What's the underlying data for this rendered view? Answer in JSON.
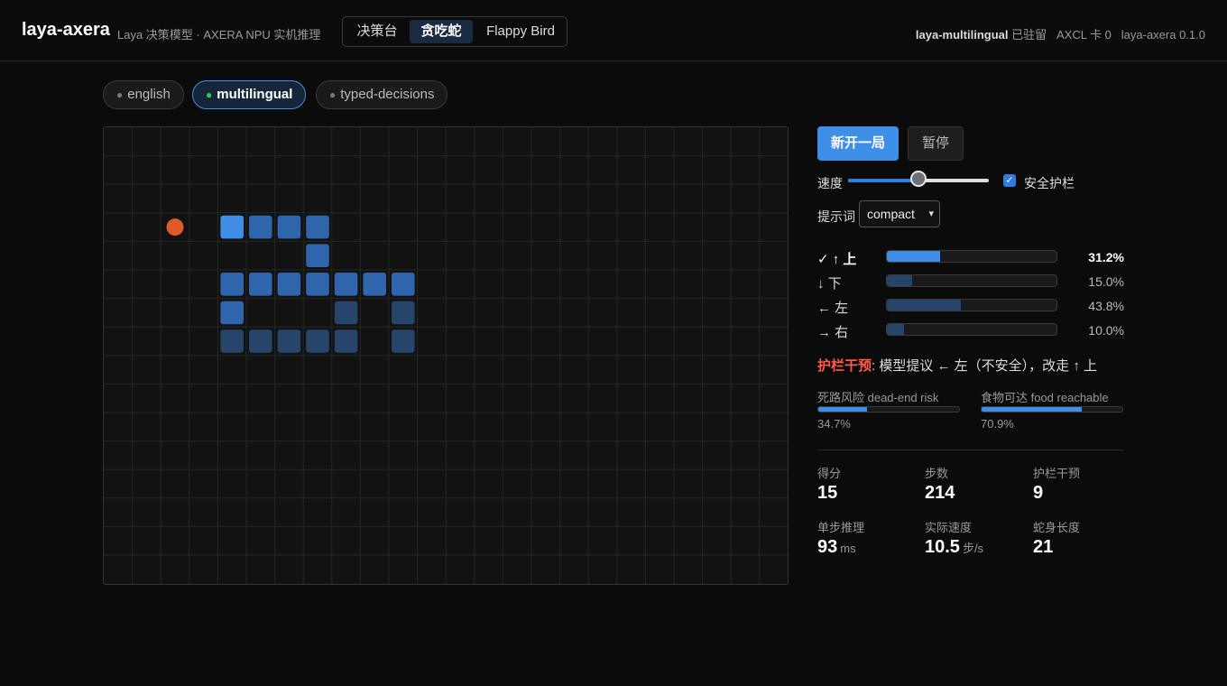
{
  "header": {
    "brand": "laya-axera",
    "subtitle": "Laya 决策模型 · AXERA NPU 实机推理",
    "nav_tabs": [
      {
        "label": "决策台",
        "active": false
      },
      {
        "label": "贪吃蛇",
        "active": true
      },
      {
        "label": "Flappy Bird",
        "active": false
      }
    ],
    "status_model": "laya-multilingual",
    "status_resident": "已驻留",
    "status_card": "AXCL 卡 0",
    "status_version": "laya-axera 0.1.0"
  },
  "model_pills": [
    {
      "label": "english",
      "active": false
    },
    {
      "label": "multilingual",
      "active": true
    },
    {
      "label": "typed-decisions",
      "active": false
    }
  ],
  "board": {
    "cols": 24,
    "rows": 16,
    "food": {
      "col": 2,
      "row": 3,
      "color": "#e05a28"
    },
    "snake_head": {
      "col": 4,
      "row": 3
    },
    "snake_body": [
      [
        5,
        3
      ],
      [
        6,
        3
      ],
      [
        7,
        3
      ],
      [
        7,
        4
      ],
      [
        4,
        5
      ],
      [
        5,
        5
      ],
      [
        6,
        5
      ],
      [
        7,
        5
      ],
      [
        8,
        5
      ],
      [
        9,
        5
      ],
      [
        10,
        5
      ],
      [
        4,
        6
      ],
      [
        8,
        6
      ],
      [
        10,
        6
      ],
      [
        4,
        7
      ],
      [
        5,
        7
      ],
      [
        6,
        7
      ],
      [
        7,
        7
      ],
      [
        8,
        7
      ],
      [
        10,
        7
      ]
    ],
    "colors": {
      "head": "#3f8ee8",
      "body": "#2f65ad",
      "tail": "#27446b",
      "grid": "#262626"
    }
  },
  "controls": {
    "new_game": "新开一局",
    "pause": "暂停",
    "speed_label": "速度",
    "speed_level": 0.5,
    "guard_label": "安全护栏",
    "guard_checked": true,
    "checkmark": "✓",
    "prompt_label": "提示词",
    "prompt_value": "compact",
    "prompt_caret": "▾"
  },
  "actions": [
    {
      "label": "✓ ↑ 上",
      "pct_text": "31.2%",
      "value": 0.312,
      "chosen": true
    },
    {
      "label": "↓ 下",
      "pct_text": "15.0%",
      "value": 0.15,
      "chosen": false
    },
    {
      "label": "← 左",
      "pct_text": "43.8%",
      "value": 0.438,
      "chosen": false
    },
    {
      "label": "→ 右",
      "pct_text": "10.0%",
      "value": 0.1,
      "chosen": false
    }
  ],
  "guard_notice": {
    "tag": "护栏干预",
    "text": ": 模型提议 ← 左（不安全），改走 ↑ 上"
  },
  "risks": [
    {
      "label": "死路风险 dead-end risk",
      "value_text": "34.7%",
      "value": 0.347
    },
    {
      "label": "食物可达 food reachable",
      "value_text": "70.9%",
      "value": 0.709
    }
  ],
  "stats": [
    {
      "label": "得分",
      "value": "15",
      "unit": ""
    },
    {
      "label": "步数",
      "value": "214",
      "unit": ""
    },
    {
      "label": "护栏干预",
      "value": "9",
      "unit": ""
    },
    {
      "label": "单步推理",
      "value": "93",
      "unit": "ms"
    },
    {
      "label": "实际速度",
      "value": "10.5",
      "unit": "步/s"
    },
    {
      "label": "蛇身长度",
      "value": "21",
      "unit": ""
    }
  ]
}
